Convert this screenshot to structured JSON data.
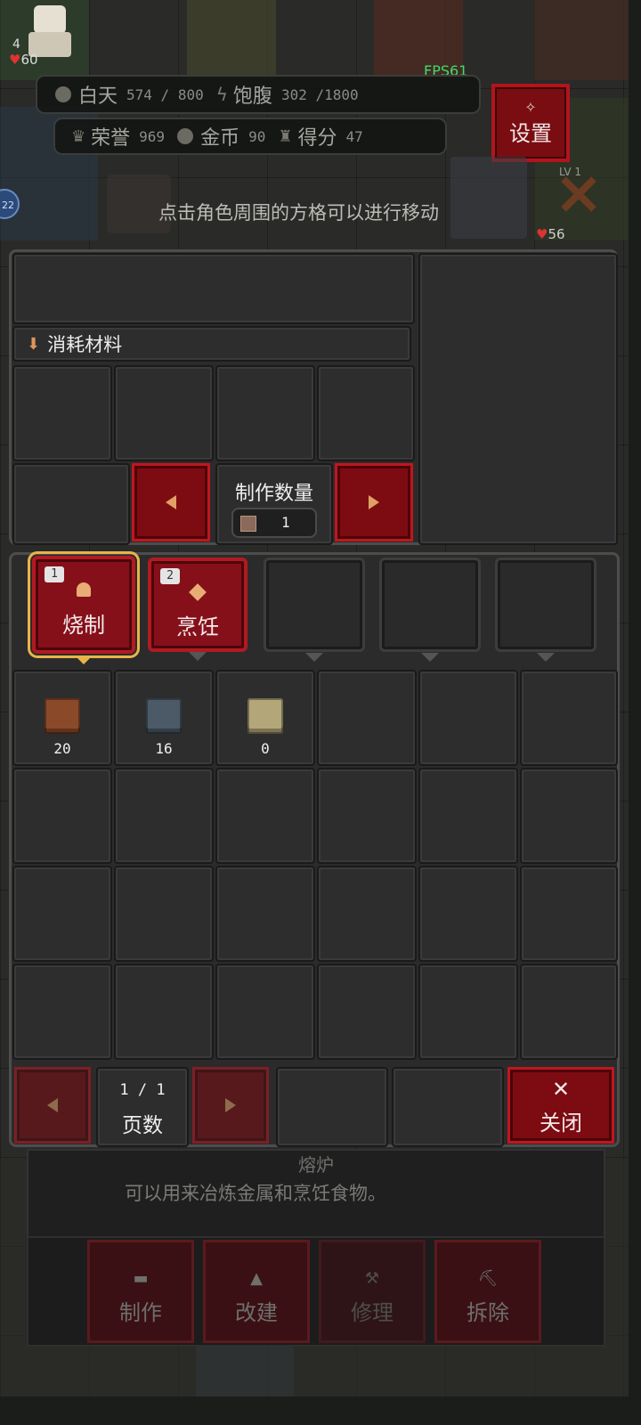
{
  "hud": {
    "player_hp": "60",
    "player_level": "4",
    "fps": "FPS61",
    "day_label": "白天",
    "day_value": "574 / 800",
    "satiety_label": "饱腹",
    "satiety_value": "302 /1800",
    "honor_label": "荣誉",
    "honor_value": "969",
    "gold_label": "金币",
    "gold_value": "90",
    "score_label": "得分",
    "score_value": "47",
    "settings_label": "设置",
    "enemy_level": "LV 1",
    "enemy_hp": "56",
    "side_badge": "22",
    "hint": "点击角色周围的方格可以进行移动"
  },
  "craft": {
    "materials_label": "消耗材料",
    "quantity_label": "制作数量",
    "quantity_value": "1"
  },
  "tabs": [
    {
      "key": "1",
      "label": "烧制",
      "selected": true
    },
    {
      "key": "2",
      "label": "烹饪",
      "selected": false
    },
    {
      "key": "",
      "label": "",
      "selected": false
    },
    {
      "key": "",
      "label": "",
      "selected": false
    },
    {
      "key": "",
      "label": "",
      "selected": false
    }
  ],
  "items": [
    {
      "name": "brick-red",
      "count": "20",
      "color": "#8a4a2a"
    },
    {
      "name": "brick-gray",
      "count": "16",
      "color": "#4b5a66"
    },
    {
      "name": "brick-sand",
      "count": "0",
      "color": "#b3a77a"
    }
  ],
  "pager": {
    "page_text": "1 / 1",
    "page_label": "页数",
    "close_label": "关闭"
  },
  "building": {
    "name": "熔炉",
    "desc": "可以用来冶炼金属和烹饪食物。",
    "actions": [
      "制作",
      "改建",
      "修理",
      "拆除"
    ]
  },
  "colors": {
    "accent_red": "#b3141c",
    "selected_outline": "#e8b44a",
    "fps_green": "#3ddc6a"
  }
}
